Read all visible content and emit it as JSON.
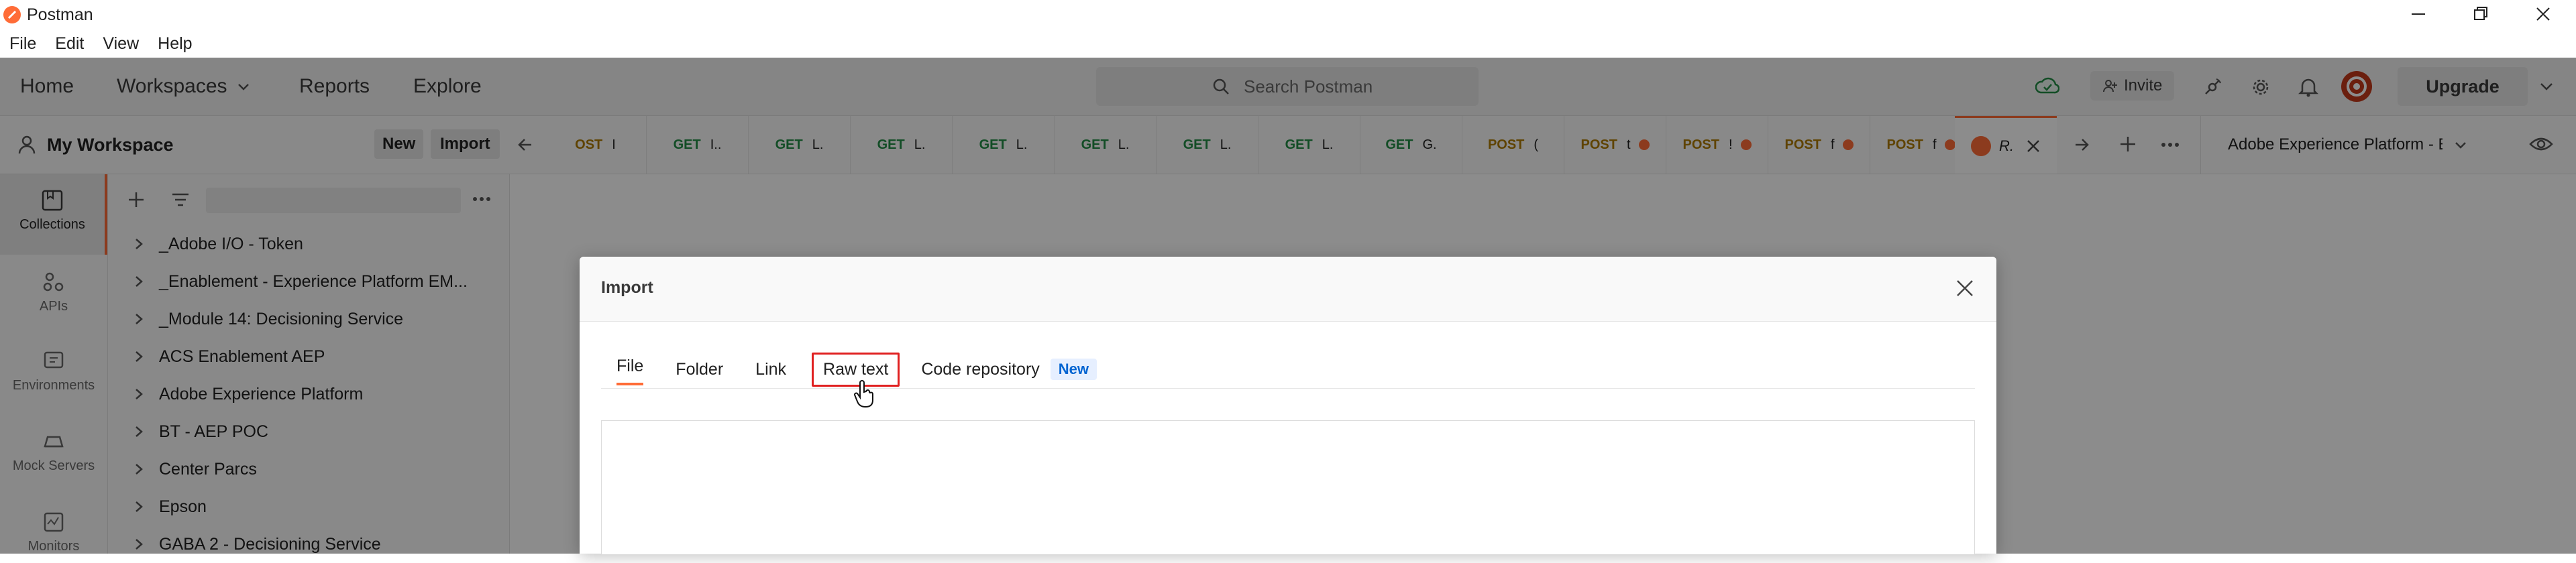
{
  "window": {
    "title": "Postman"
  },
  "menubar": {
    "items": [
      "File",
      "Edit",
      "View",
      "Help"
    ]
  },
  "header": {
    "nav": [
      "Home",
      "Workspaces",
      "Reports",
      "Explore"
    ],
    "search_placeholder": "Search Postman",
    "invite_label": "Invite",
    "upgrade_label": "Upgrade"
  },
  "workspace": {
    "name": "My Workspace",
    "new_label": "New",
    "import_label": "Import"
  },
  "rail": [
    "Collections",
    "APIs",
    "Environments",
    "Mock Servers",
    "Monitors"
  ],
  "collections": [
    "_Adobe I/O - Token",
    "_Enablement - Experience Platform EM...",
    "_Module 14: Decisioning Service",
    "ACS Enablement AEP",
    "Adobe Experience Platform",
    "BT - AEP POC",
    "Center Parcs",
    "Epson",
    "GABA 2 - Decisioning Service"
  ],
  "tabs": [
    {
      "method": "OST",
      "name": "I",
      "dot": false
    },
    {
      "method": "GET",
      "name": "I..",
      "dot": false
    },
    {
      "method": "GET",
      "name": "L.",
      "dot": false
    },
    {
      "method": "GET",
      "name": "L.",
      "dot": false
    },
    {
      "method": "GET",
      "name": "L.",
      "dot": false
    },
    {
      "method": "GET",
      "name": "L.",
      "dot": false
    },
    {
      "method": "GET",
      "name": "L.",
      "dot": false
    },
    {
      "method": "GET",
      "name": "L.",
      "dot": false
    },
    {
      "method": "GET",
      "name": "G.",
      "dot": false
    },
    {
      "method": "POST",
      "name": "(",
      "dot": false
    },
    {
      "method": "POST",
      "name": "t",
      "dot": true
    },
    {
      "method": "POST",
      "name": "!",
      "dot": true
    },
    {
      "method": "POST",
      "name": "f",
      "dot": true
    },
    {
      "method": "POST",
      "name": "f",
      "dot": true
    }
  ],
  "active_tab": {
    "name": "R."
  },
  "environment": {
    "selected": "Adobe Experience Platform - En"
  },
  "modal": {
    "title": "Import",
    "tabs": [
      "File",
      "Folder",
      "Link",
      "Raw text",
      "Code repository"
    ],
    "new_badge": "New",
    "active_tab": "File",
    "highlighted_tab": "Raw text"
  },
  "colors": {
    "accent": "#ff6c37",
    "highlight": "#e02020",
    "badge_bg": "#e6efff",
    "badge_text": "#0265d2"
  }
}
